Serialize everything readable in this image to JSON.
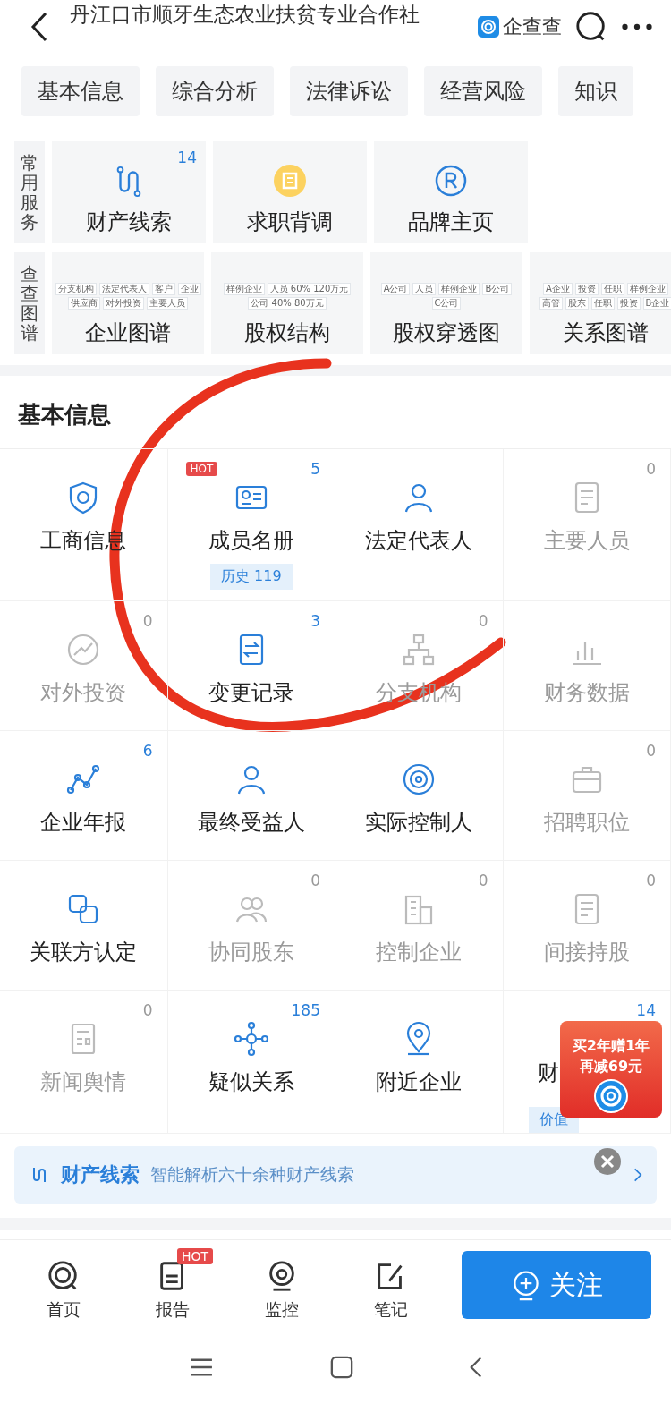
{
  "header": {
    "title": "丹江口市顺牙生态农业扶贫专业合作社",
    "brand": "企查查"
  },
  "tabs": [
    "基本信息",
    "综合分析",
    "法律诉讼",
    "经营风险",
    "知识"
  ],
  "services": {
    "label": "常用服务",
    "items": [
      {
        "label": "财产线索",
        "count": "14"
      },
      {
        "label": "求职背调"
      },
      {
        "label": "品牌主页"
      }
    ]
  },
  "graphs": {
    "label": "查查图谱",
    "items": [
      {
        "label": "企业图谱",
        "thumb": [
          "分支机构",
          "法定代表人",
          "客户",
          "企业",
          "供应商",
          "对外投资",
          "主要人员"
        ]
      },
      {
        "label": "股权结构",
        "thumb": [
          "样例企业",
          "人员 60% 120万元",
          "公司 40% 80万元"
        ]
      },
      {
        "label": "股权穿透图",
        "thumb": [
          "A公司",
          "人员",
          "样例企业",
          "B公司",
          "C公司"
        ]
      },
      {
        "label": "关系图谱",
        "thumb": [
          "A企业",
          "投资",
          "任职",
          "样例企业",
          "高管",
          "股东",
          "任职",
          "投资",
          "B企业"
        ]
      }
    ]
  },
  "section_title": "基本信息",
  "grid": [
    {
      "label": "工商信息",
      "disabled": false
    },
    {
      "label": "成员名册",
      "count": "5",
      "hot": "HOT",
      "tag": "历史 119",
      "disabled": false
    },
    {
      "label": "法定代表人",
      "disabled": false
    },
    {
      "label": "主要人员",
      "count": "0",
      "disabled": true
    },
    {
      "label": "对外投资",
      "count": "0",
      "disabled": true
    },
    {
      "label": "变更记录",
      "count": "3",
      "disabled": false
    },
    {
      "label": "分支机构",
      "count": "0",
      "disabled": true
    },
    {
      "label": "财务数据",
      "disabled": true
    },
    {
      "label": "企业年报",
      "count": "6",
      "disabled": false
    },
    {
      "label": "最终受益人",
      "disabled": false
    },
    {
      "label": "实际控制人",
      "disabled": false
    },
    {
      "label": "招聘职位",
      "count": "0",
      "disabled": true
    },
    {
      "label": "关联方认定",
      "disabled": false
    },
    {
      "label": "协同股东",
      "count": "0",
      "disabled": true
    },
    {
      "label": "控制企业",
      "count": "0",
      "disabled": true
    },
    {
      "label": "间接持股",
      "count": "0",
      "disabled": true
    },
    {
      "label": "新闻舆情",
      "count": "0",
      "disabled": true
    },
    {
      "label": "疑似关系",
      "count": "185",
      "disabled": false
    },
    {
      "label": "附近企业",
      "disabled": false
    },
    {
      "label": "财",
      "count": "14",
      "tag": "价值",
      "disabled": false
    }
  ],
  "promo": {
    "line1": "买2年赠1年",
    "line2": "再减69元"
  },
  "banner": {
    "title": "财产线索",
    "text": "智能解析六十余种财产线索"
  },
  "bottom_nav": [
    {
      "label": "首页"
    },
    {
      "label": "报告",
      "hot": "HOT"
    },
    {
      "label": "监控"
    },
    {
      "label": "笔记"
    }
  ],
  "follow_button": "关注"
}
